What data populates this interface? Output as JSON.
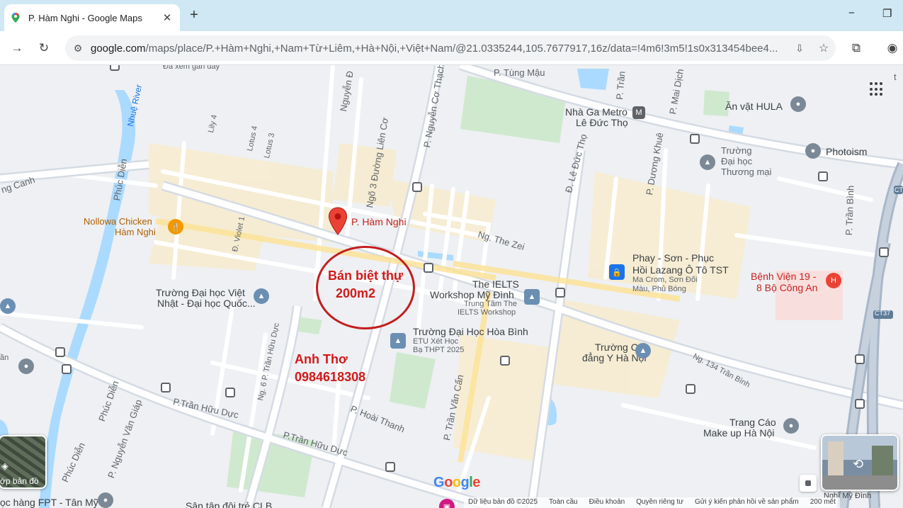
{
  "browser": {
    "tab_title": "P. Hàm Nghi - Google Maps",
    "tab_close": "✕",
    "new_tab": "+",
    "url_host": "google.com",
    "url_path": "/maps/place/P.+Hàm+Nghi,+Nam+Từ+Liêm,+Hà+Nội,+Việt+Nam/@21.0335244,105.7677917,16z/data=!4m6!3m5!1s0x313454bee4...",
    "minimize": "−",
    "restore": "❐"
  },
  "map": {
    "pin_label": "P. Hàm Nghi",
    "annotation_offer": [
      "Bán biệt thự",
      "200m2"
    ],
    "annotation_contact": [
      "Anh Thơ",
      "0984618308"
    ],
    "places": {
      "seen_recently": "Đã xem gần đây",
      "metro": [
        "Nhà Ga Metro",
        "Lê Đức Thọ"
      ],
      "an_vat": "Ăn vặt HULA",
      "photoism": "Photoism",
      "thuong_mai": [
        "Trường",
        "Đại học",
        "Thương mại"
      ],
      "nollowa": [
        "Nollowa Chicken",
        "Hàm Nghi"
      ],
      "phay_son": [
        "Phay - Sơn - Phục",
        "Hồi Lazang Ô Tô TST"
      ],
      "phay_son_sub": [
        "Ma Crom, Sơn Đối",
        "Màu, Phủ Bóng"
      ],
      "benh_vien": [
        "Bệnh Viện 19 -",
        "8 Bộ Công An"
      ],
      "ielts": [
        "The IELTS",
        "Workshop Mỹ Đình"
      ],
      "ielts_sub": [
        "Trung Tâm The",
        "IELTS Workshop"
      ],
      "viet_nhat": [
        "Trường Đại học Việt",
        "Nhật - Đại học Quốc..."
      ],
      "hoa_binh": "Trường Đại Học Hòa Bình",
      "hoa_binh_sub": [
        "ETU Xét Học",
        "Bạ THPT 2025"
      ],
      "cao_dang": [
        "Trường Cao",
        "đẳng Y Hà Nội"
      ],
      "trang_cao": [
        "Trang Cáo",
        "Make up Hà Nội"
      ],
      "fpt": "ọc hàng FPT - Tân Mỹ",
      "san_tap": "Sân tập đội trẻ CLB",
      "nghi_my_dinh": "Nghĩ Mỹ Đình",
      "left_cut": "ần",
      "left_cut_letter": "t"
    },
    "streets": {
      "tung_mau": "P. Tùng Mậu",
      "nguyen_co_thach": "P. Nguyễn Cơ Thạch",
      "ngo3": "Ngõ 3 Đường Liên Cơ",
      "le_duc_tho": "Đ. Lê Đức Thọ",
      "duong_khue": "P. Dương Khuê",
      "mai_dich": "P. Mai Dịch",
      "tran": "P. Trần",
      "tran_binh": "P. Trần Bình",
      "nguyen_d": "Nguyễn Đ",
      "lily4": "Lily 4",
      "lotus4": "Lotus 4",
      "lotus3": "Lotus 3",
      "phuc_dien": "Phúc Diễn",
      "phuc_dien2": "Phúc Diễn",
      "phuc_dien3": "Phúc Diễn",
      "nhue_river": "Nhuệ River",
      "canh": "ng Canh",
      "the_zei": "Ng. The Zei",
      "violet": "Đ. Violet 1",
      "ng6": "Ng. 6 P. Trần Hữu Dực",
      "tran_huu_duc": "P.Trần Hữu Dực",
      "tran_huu_duc2": "P.Trần Hữu Dực",
      "hoai_thanh": "P. Hoài Thanh",
      "tran_van_can": "P. Trần Văn Cẩn",
      "nguyen_van_giap": "P. Nguyễn Văn Giáp",
      "ng134": "Ng. 134 Trần Bình",
      "ct37": "CT37",
      "ct": "CT"
    },
    "layers_label": "ớp bản đồ",
    "google_logo": "Google",
    "footer": [
      "Dữ liệu bản đồ ©2025",
      "Toàn cầu",
      "Điều khoản",
      "Quyền riêng tư",
      "Gửi ý kiến phản hồi về sản phẩm",
      "200 mét"
    ]
  },
  "colors": {
    "pin": "#ea4335",
    "annotation": "#d11a1a",
    "water": "#aadaff",
    "park": "#c8e6c9",
    "major_road": "#f9e7b3",
    "road": "#ffffff",
    "highway": "#9aa8bb"
  }
}
